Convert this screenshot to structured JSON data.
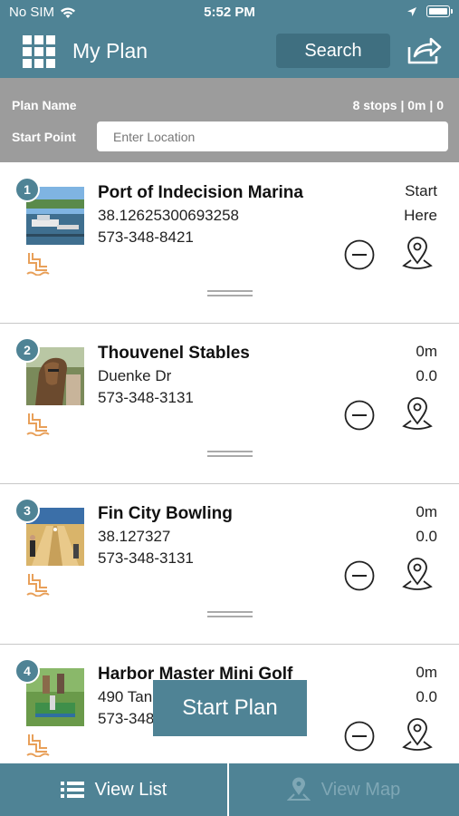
{
  "status": {
    "carrier": "No SIM",
    "time": "5:52 PM"
  },
  "header": {
    "title": "My Plan",
    "search_label": "Search"
  },
  "plan": {
    "name_label": "Plan Name",
    "stats": "8 stops | 0m | 0",
    "start_label": "Start Point",
    "start_placeholder": "Enter Location"
  },
  "stops": [
    {
      "number": "1",
      "name": "Port of Indecision Marina",
      "line1": "38.12625300693258",
      "line2": "573-348-8421",
      "dist1": "Start",
      "dist2": "Here"
    },
    {
      "number": "2",
      "name": "Thouvenel Stables",
      "line1": "Duenke Dr",
      "line2": "573-348-3131",
      "dist1": "0m",
      "dist2": "0.0"
    },
    {
      "number": "3",
      "name": "Fin City Bowling",
      "line1": "38.127327",
      "line2": "573-348-3131",
      "dist1": "0m",
      "dist2": "0.0"
    },
    {
      "number": "4",
      "name": "Harbor Master Mini Golf",
      "line1": "490 Tan",
      "line2": "573-348",
      "dist1": "0m",
      "dist2": "0.0"
    }
  ],
  "start_plan_label": "Start Plan",
  "tabs": {
    "view_list": "View List",
    "view_map": "View Map"
  },
  "colors": {
    "primary": "#4f8395",
    "primary_dark": "#3f6f80",
    "plan_bar": "#9c9c9c",
    "category": "#e8a05a"
  }
}
